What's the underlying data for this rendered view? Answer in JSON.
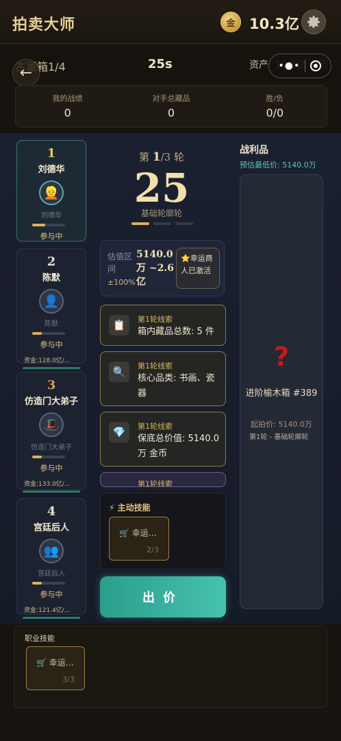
{
  "app": {
    "title": "拍卖大师",
    "coin_symbol": "金",
    "balance": "10.3亿"
  },
  "status": {
    "box_label": "古董箱1/4",
    "timer": "25s",
    "assets": "资产: 10.3亿 金币"
  },
  "stats": [
    {
      "label": "我的战绩",
      "value": "0"
    },
    {
      "label": "对手总藏品",
      "value": "0"
    },
    {
      "label": "胜/负",
      "value": "0/0"
    }
  ],
  "players": [
    {
      "rank": "1",
      "name": "刘德华",
      "sub": "刘德华",
      "state": "参与中",
      "funds": "",
      "progress": 0.4,
      "avatar": "👱"
    },
    {
      "rank": "2",
      "name": "陈默",
      "sub": "陈默",
      "state": "参与中",
      "funds": "资金:128.0亿/...",
      "progress": 0.3,
      "avatar": "👤"
    },
    {
      "rank": "3",
      "name": "仿造门大弟子",
      "sub": "仿造门大弟子",
      "state": "参与中",
      "funds": "资金:133.0亿/...",
      "progress": 0.3,
      "avatar": "🎩"
    },
    {
      "rank": "4",
      "name": "宫廷后人",
      "sub": "宫廷后人",
      "state": "参与中",
      "funds": "资金:121.4亿/...",
      "progress": 0.3,
      "avatar": "👥"
    }
  ],
  "round": {
    "prefix": "第",
    "current": "1",
    "total": "/3",
    "suffix": "轮",
    "countdown": "25",
    "name": "基础轮廓轮"
  },
  "estimate": {
    "label": "估值区间",
    "value": "5140.0万 ~2.6亿",
    "pm": "±100%",
    "lucky": "⭐幸运商人已激活"
  },
  "clues": [
    {
      "title": "第1轮线索",
      "text": "箱内藏品总数: 5 件",
      "icon": "clipboard-icon"
    },
    {
      "title": "第1轮线索",
      "text": "核心品类: 书画、瓷器",
      "icon": "magnifier-icon"
    },
    {
      "title": "第1轮线索",
      "text": "保底总价值: 5140.0万 金币",
      "icon": "diamond-icon"
    },
    {
      "title": "第1轮线索",
      "text": "",
      "icon": "clue-icon"
    }
  ],
  "skills": {
    "header": "⚡ 主动技能",
    "card_name": "🛒 幸运…",
    "card_count": "2/3"
  },
  "bid_label": "出价",
  "loot": {
    "title": "战利品",
    "min_label": "预估最低价: 5140.0万",
    "mark": "?",
    "name": "进阶榆木箱 #389",
    "start": "起拍价: 5140.0万",
    "round": "第1轮 - 基础轮廓轮"
  },
  "career": {
    "label": "职业技能",
    "card_name": "🛒 幸运…",
    "card_count": "3/3"
  },
  "colors": {
    "accent_teal": "#46c2ae",
    "gold": "#e7cf96",
    "question": "#c51a1a"
  }
}
